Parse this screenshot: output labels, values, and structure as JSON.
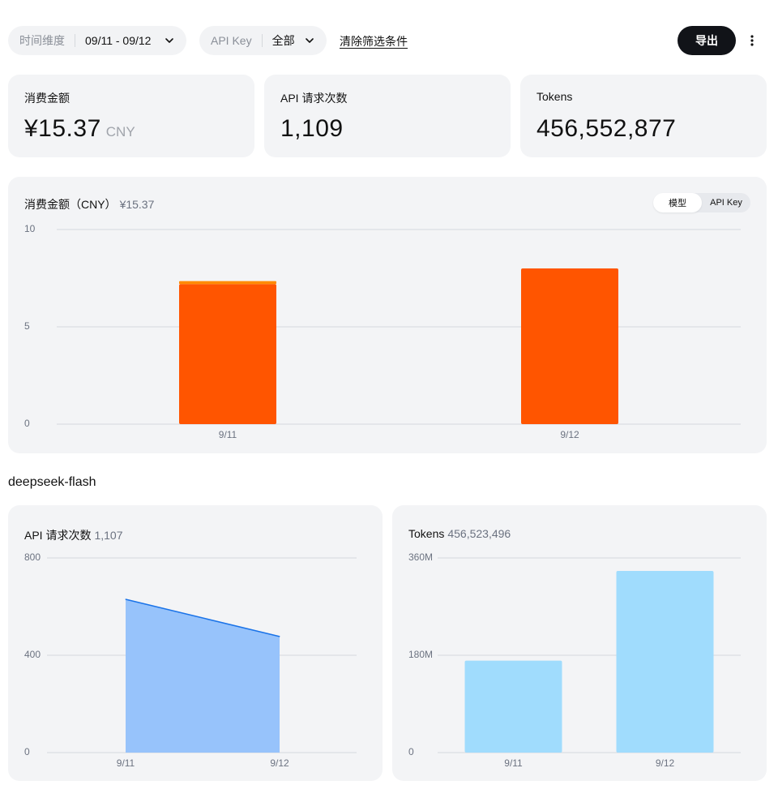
{
  "filters": {
    "time_label": "时间维度",
    "time_value": "09/11 - 09/12",
    "apikey_label": "API Key",
    "apikey_value": "全部",
    "clear_label": "清除筛选条件",
    "export_label": "导出"
  },
  "stats": [
    {
      "label": "消费金额",
      "value": "¥15.37",
      "unit": "CNY"
    },
    {
      "label": "API 请求次数",
      "value": "1,109",
      "unit": ""
    },
    {
      "label": "Tokens",
      "value": "456,552,877",
      "unit": ""
    }
  ],
  "cost_chart": {
    "title": "消费金额（CNY）",
    "total": "¥15.37",
    "toggle": [
      "模型",
      "API Key"
    ],
    "toggle_active": 0
  },
  "section": {
    "heading": "deepseek-flash"
  },
  "requests_chart": {
    "title": "API 请求次数",
    "total": "1,107"
  },
  "tokens_chart": {
    "title": "Tokens",
    "total": "456,523,496"
  },
  "colors": {
    "cost_bar": "#ff5500",
    "cost_bar_top": "#ff8a00",
    "area_fill": "#97c3fb",
    "area_line": "#1a73e8",
    "token_bar": "#a0dcfd"
  },
  "chart_data": [
    {
      "type": "bar",
      "title": "消费金额（CNY）",
      "categories": [
        "9/11",
        "9/12"
      ],
      "series": [
        {
          "name": "deepseek-flash",
          "values": [
            7.2,
            8.0
          ]
        }
      ],
      "secondary_sliver": [
        0.15,
        0
      ],
      "yticks": [
        "0",
        "5",
        "10"
      ],
      "ylim": [
        0,
        10
      ],
      "grid": true
    },
    {
      "type": "area",
      "title": "API 请求次数",
      "categories": [
        "9/11",
        "9/12"
      ],
      "values": [
        630,
        477
      ],
      "yticks": [
        "0",
        "400",
        "800"
      ],
      "ylim": [
        0,
        800
      ],
      "grid": true
    },
    {
      "type": "bar",
      "title": "Tokens",
      "categories": [
        "9/11",
        "9/12"
      ],
      "values": [
        170000000,
        336000000
      ],
      "yticks": [
        "0",
        "180M",
        "360M"
      ],
      "ylim": [
        0,
        360000000
      ],
      "grid": true
    }
  ]
}
